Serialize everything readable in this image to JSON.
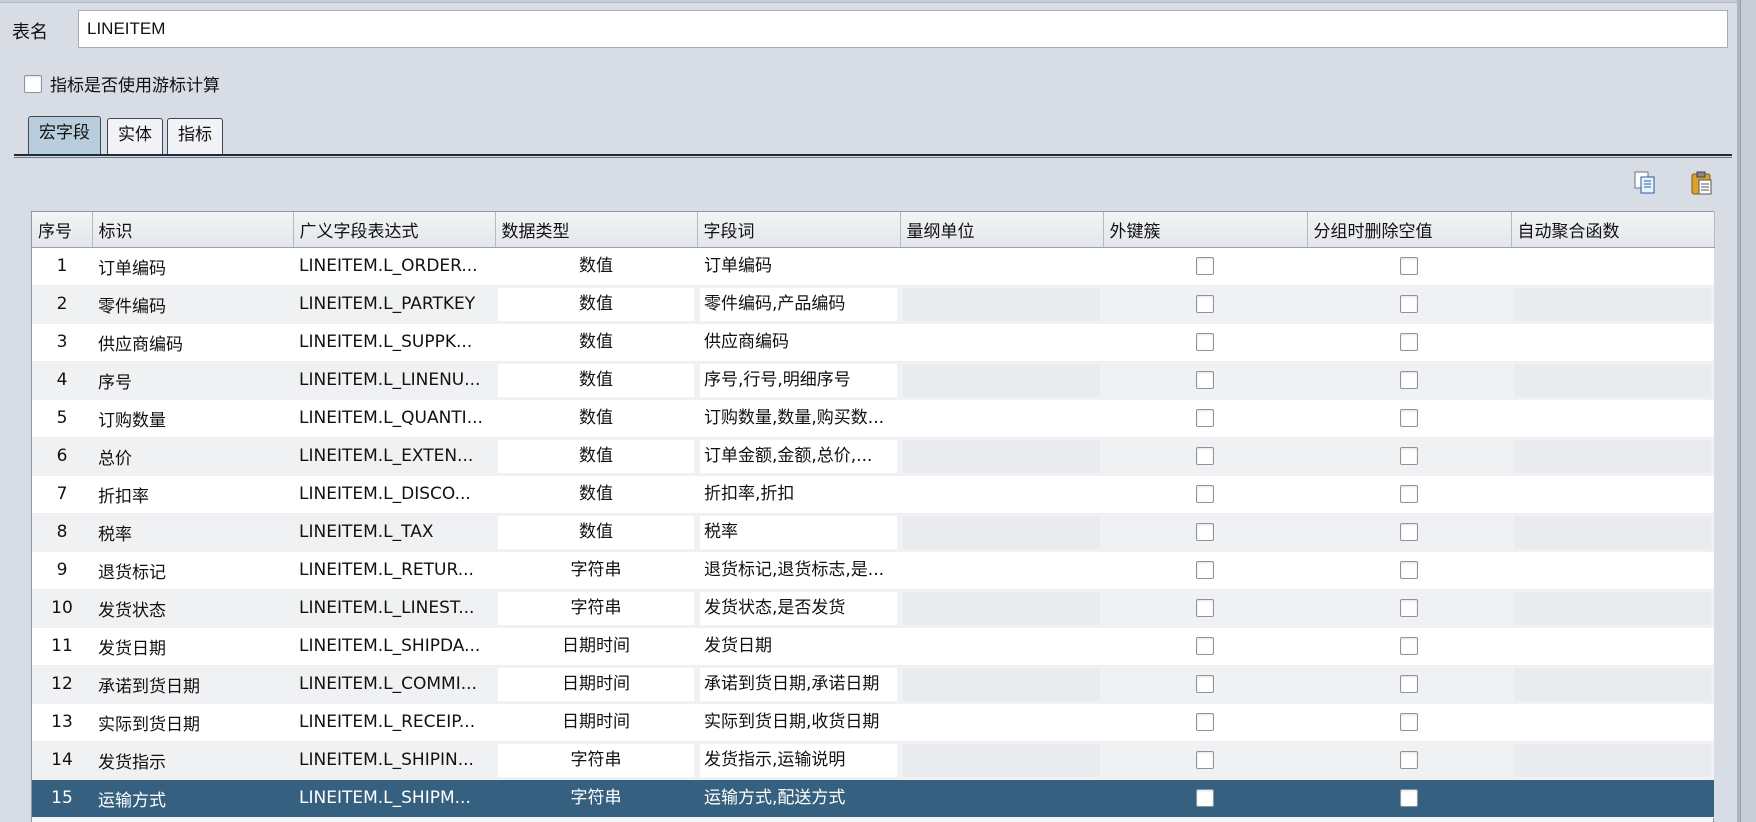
{
  "form": {
    "table_name_label": "表名",
    "table_name_value": "LINEITEM",
    "cursor_checkbox_label": "指标是否使用游标计算"
  },
  "tabs": [
    {
      "label": "宏字段",
      "active": true
    },
    {
      "label": "实体",
      "active": false
    },
    {
      "label": "指标",
      "active": false
    }
  ],
  "toolbar": {
    "copy_icon": "copy-icon",
    "paste_icon": "paste-icon"
  },
  "table": {
    "headers": [
      "序号",
      "标识",
      "广义字段表达式",
      "数据类型",
      "字段词",
      "量纲单位",
      "外键簇",
      "分组时删除空值",
      "自动聚合函数"
    ],
    "rows": [
      {
        "num": "1",
        "id": "订单编码",
        "expr": "LINEITEM.L_ORDER...",
        "type": "数值",
        "words": "订单编码",
        "unit": "",
        "agg": ""
      },
      {
        "num": "2",
        "id": "零件编码",
        "expr": "LINEITEM.L_PARTKEY",
        "type": "数值",
        "words": "零件编码,产品编码",
        "unit": "",
        "agg": ""
      },
      {
        "num": "3",
        "id": "供应商编码",
        "expr": "LINEITEM.L_SUPPK...",
        "type": "数值",
        "words": "供应商编码",
        "unit": "",
        "agg": ""
      },
      {
        "num": "4",
        "id": "序号",
        "expr": "LINEITEM.L_LINENU...",
        "type": "数值",
        "words": "序号,行号,明细序号",
        "unit": "",
        "agg": ""
      },
      {
        "num": "5",
        "id": "订购数量",
        "expr": "LINEITEM.L_QUANTI...",
        "type": "数值",
        "words": "订购数量,数量,购买数...",
        "unit": "",
        "agg": ""
      },
      {
        "num": "6",
        "id": "总价",
        "expr": "LINEITEM.L_EXTEN...",
        "type": "数值",
        "words": "订单金额,金额,总价,...",
        "unit": "",
        "agg": ""
      },
      {
        "num": "7",
        "id": "折扣率",
        "expr": "LINEITEM.L_DISCO...",
        "type": "数值",
        "words": "折扣率,折扣",
        "unit": "",
        "agg": ""
      },
      {
        "num": "8",
        "id": "税率",
        "expr": "LINEITEM.L_TAX",
        "type": "数值",
        "words": "税率",
        "unit": "",
        "agg": ""
      },
      {
        "num": "9",
        "id": "退货标记",
        "expr": "LINEITEM.L_RETUR...",
        "type": "字符串",
        "words": "退货标记,退货标志,是...",
        "unit": "",
        "agg": ""
      },
      {
        "num": "10",
        "id": "发货状态",
        "expr": "LINEITEM.L_LINEST...",
        "type": "字符串",
        "words": "发货状态,是否发货",
        "unit": "",
        "agg": ""
      },
      {
        "num": "11",
        "id": "发货日期",
        "expr": "LINEITEM.L_SHIPDA...",
        "type": "日期时间",
        "words": "发货日期",
        "unit": "",
        "agg": ""
      },
      {
        "num": "12",
        "id": "承诺到货日期",
        "expr": "LINEITEM.L_COMMI...",
        "type": "日期时间",
        "words": "承诺到货日期,承诺日期",
        "unit": "",
        "agg": ""
      },
      {
        "num": "13",
        "id": "实际到货日期",
        "expr": "LINEITEM.L_RECEIP...",
        "type": "日期时间",
        "words": "实际到货日期,收货日期",
        "unit": "",
        "agg": ""
      },
      {
        "num": "14",
        "id": "发货指示",
        "expr": "LINEITEM.L_SHIPIN...",
        "type": "字符串",
        "words": "发货指示,运输说明",
        "unit": "",
        "agg": ""
      },
      {
        "num": "15",
        "id": "运输方式",
        "expr": "LINEITEM.L_SHIPM...",
        "type": "字符串",
        "words": "运输方式,配送方式",
        "unit": "",
        "agg": "",
        "selected": true
      }
    ]
  },
  "colors": {
    "selection": "#36607f",
    "active_tab": "#b9cedd"
  }
}
